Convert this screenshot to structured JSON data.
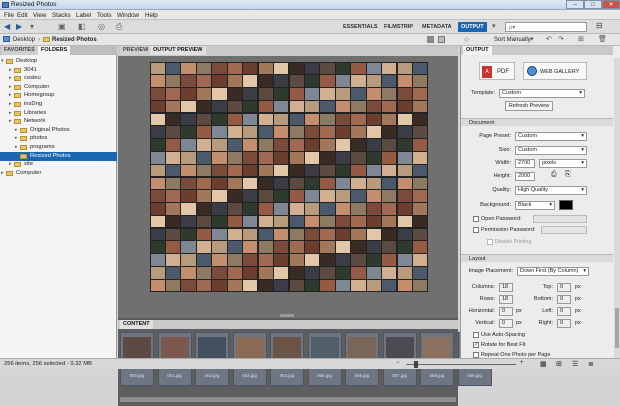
{
  "window": {
    "title": "Resized Photos",
    "min": "–",
    "max": "□",
    "close": "✕"
  },
  "menu": [
    "File",
    "Edit",
    "View",
    "Stacks",
    "Label",
    "Tools",
    "Window",
    "Help"
  ],
  "workspaces": [
    "ESSENTIALS",
    "FILMSTRIP",
    "METADATA",
    "OUTPUT"
  ],
  "search": {
    "placeholder": "ρ▾"
  },
  "path": {
    "crumbs": [
      "Desktop",
      "Resized Photos"
    ],
    "sort": "Sort Manually"
  },
  "left_panel": {
    "tabs": [
      "FAVORITES",
      "FOLDERS"
    ],
    "tree": [
      "Desktop",
      "3041",
      "cosleu",
      "Computer",
      "Homegroup",
      "insDng",
      "Libraries",
      "Network",
      "Original Photos",
      "photos",
      "programs",
      "Resized Photos",
      "site",
      "Computer"
    ]
  },
  "center": {
    "tabs": [
      "PREVIEW",
      "OUTPUT PREVIEW"
    ],
    "content_tab": "CONTENT",
    "thumbs": [
      "060.jpg",
      "061.jpg",
      "062.jpg",
      "063.jpg",
      "064.jpg",
      "065.jpg",
      "066.jpg",
      "067.jpg",
      "068.jpg",
      "069.jpg"
    ]
  },
  "output": {
    "panel_title": "OUTPUT",
    "pdf": "PDF",
    "web": "WEB GALLERY",
    "template_label": "Template:",
    "template": "Custom",
    "refresh": "Refresh Preview",
    "document": "Document",
    "page_preset_label": "Page Preset:",
    "page_preset": "Custom",
    "size_label": "Size:",
    "size": "Custom",
    "width_label": "Width:",
    "width": "2700",
    "unit": "pixels",
    "height_label": "Height:",
    "height": "2000",
    "quality_label": "Quality:",
    "quality": "High Quality",
    "bg_label": "Background:",
    "bg": "Black",
    "open_pw": "Open Password:",
    "perm_pw": "Permission Password:",
    "disable_print": "Disable Printing",
    "layout": "Layout",
    "placement_label": "Image Placement:",
    "placement": "Down First (By Column)",
    "columns_label": "Columns:",
    "columns": "18",
    "rows_label": "Rows:",
    "rows": "18",
    "top_label": "Top:",
    "top": "0",
    "bottom_label": "Bottom:",
    "bottom": "0",
    "horiz_label": "Horizontal:",
    "horiz": "0",
    "vert_label": "Vertical:",
    "vert": "0",
    "left_label": "Left:",
    "left": "0",
    "right_label": "Right:",
    "right": "0",
    "px": "px",
    "auto_spacing": "Use Auto-Spacing",
    "rotate": "Rotate for Best Fit",
    "repeat": "Repeat One Photo per Page"
  },
  "status": "256 items, 256 selected - 9.32 MB"
}
